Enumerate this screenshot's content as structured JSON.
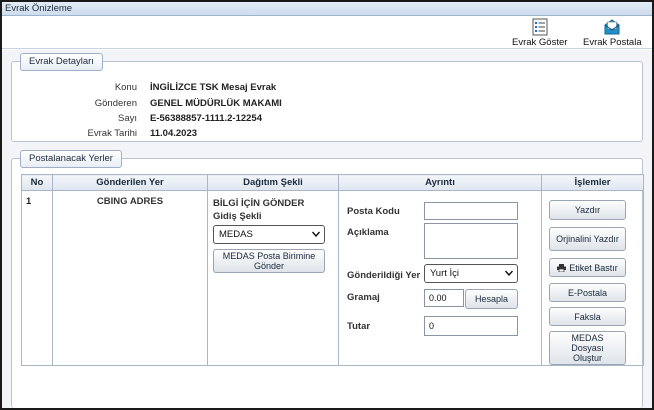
{
  "window": {
    "title": "Evrak Önizleme"
  },
  "toolbar": {
    "show_label": "Evrak Göster",
    "mail_label": "Evrak Postala"
  },
  "details": {
    "legend": "Evrak Detayları",
    "fields": [
      {
        "label": "Konu",
        "value": "İNGİLİZCE TSK Mesaj Evrak"
      },
      {
        "label": "Gönderen",
        "value": "GENEL MÜDÜRLÜK MAKAMI"
      },
      {
        "label": "Sayı",
        "value": "E-56388857-1111.2-12254"
      },
      {
        "label": "Evrak Tarihi",
        "value": "11.04.2023"
      }
    ]
  },
  "postal": {
    "legend": "Postalanacak Yerler",
    "columns": [
      "No",
      "Gönderilen Yer",
      "Dağıtım Şekli",
      "Ayrıntı",
      "İşlemler"
    ],
    "row": {
      "no": "1",
      "recipient": "CBING ADRES",
      "distribution_title": "BİLGİ İÇİN GÖNDER",
      "send_method_label": "Gidiş Şekli",
      "send_method_value": "MEDAS",
      "medas_send_button": "MEDAS Posta Birimine Gönder",
      "posta_kodu_label": "Posta Kodu",
      "posta_kodu_value": "",
      "aciklama_label": "Açıklama",
      "aciklama_value": "",
      "gonderildigi_yer_label": "Gönderildiği Yer",
      "gonderildigi_yer_value": "Yurt İçi",
      "gramaj_label": "Gramaj",
      "gramaj_value": "0.00",
      "hesapla_button": "Hesapla",
      "tutar_label": "Tutar",
      "tutar_value": "0",
      "actions": {
        "yazdir": "Yazdır",
        "orjinalini_yazdir": "Orjinalini Yazdır",
        "etiket_bastir": "Etiket Bastır",
        "e_postala": "E-Postala",
        "faksla": "Faksla",
        "medas_dosyasi": "MEDAS Dosyası Oluştur"
      }
    }
  },
  "colors": {
    "accent": "#1f6fb5",
    "header_bg": "#dfe6ef",
    "border": "#a9b6c7"
  }
}
